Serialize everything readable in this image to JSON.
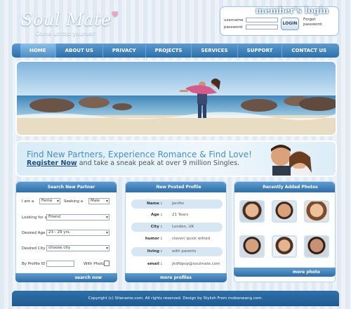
{
  "header": {
    "logo_text": "Soul Mate",
    "tagline": "Come unfold yourself",
    "login": {
      "title": "member's login",
      "username_label": "username",
      "password_label": "password",
      "button_label": "LOGIN",
      "forgot_line1": "Forgot",
      "forgot_line2": "password"
    }
  },
  "nav": {
    "items": [
      "HOME",
      "ABOUT US",
      "PRIVACY",
      "PROJECTS",
      "SERVICES",
      "SUPPORT",
      "CONTACT US"
    ],
    "active": "HOME"
  },
  "banner": {
    "headline": "Find New Partners, Experience Romance & Find Love!",
    "register_link": "Register Now",
    "rest": " and take a sneak peak at over 9 million Singles."
  },
  "search": {
    "title": "Search New Partner",
    "i_am_label": "I am a",
    "i_am_value": "Fema",
    "seeking_label": "Seeking a",
    "seeking_value": "Male",
    "looking_label": "Looking for a",
    "looking_value": "Friend",
    "age_label": "Desired Age",
    "age_value": "23 - 29 yrs.",
    "city_label": "Desired City",
    "city_value": "choose city",
    "profile_id_label": "By Profile ID",
    "with_photo_label": "With Photo",
    "submit_label": "search now"
  },
  "profile": {
    "title": "New Posted Profile",
    "rows": [
      {
        "key": "Name :",
        "value": "Jenifer"
      },
      {
        "key": "Age :",
        "value": "21 Years"
      },
      {
        "key": "City :",
        "value": "London, UK"
      },
      {
        "key": "humor :",
        "value": "clever/ quick witted"
      },
      {
        "key": "living :",
        "value": "with parents"
      },
      {
        "key": "email :",
        "value": "jkdfdpop@soulmate.com"
      }
    ],
    "more_label": "more profiles"
  },
  "photos": {
    "title": "Recently Added Photos",
    "more_label": "more photo"
  },
  "footer": {
    "text": "Copyright (c) Sitename.com. All rights reserved. Design by Stylish From mobanwang.com."
  }
}
